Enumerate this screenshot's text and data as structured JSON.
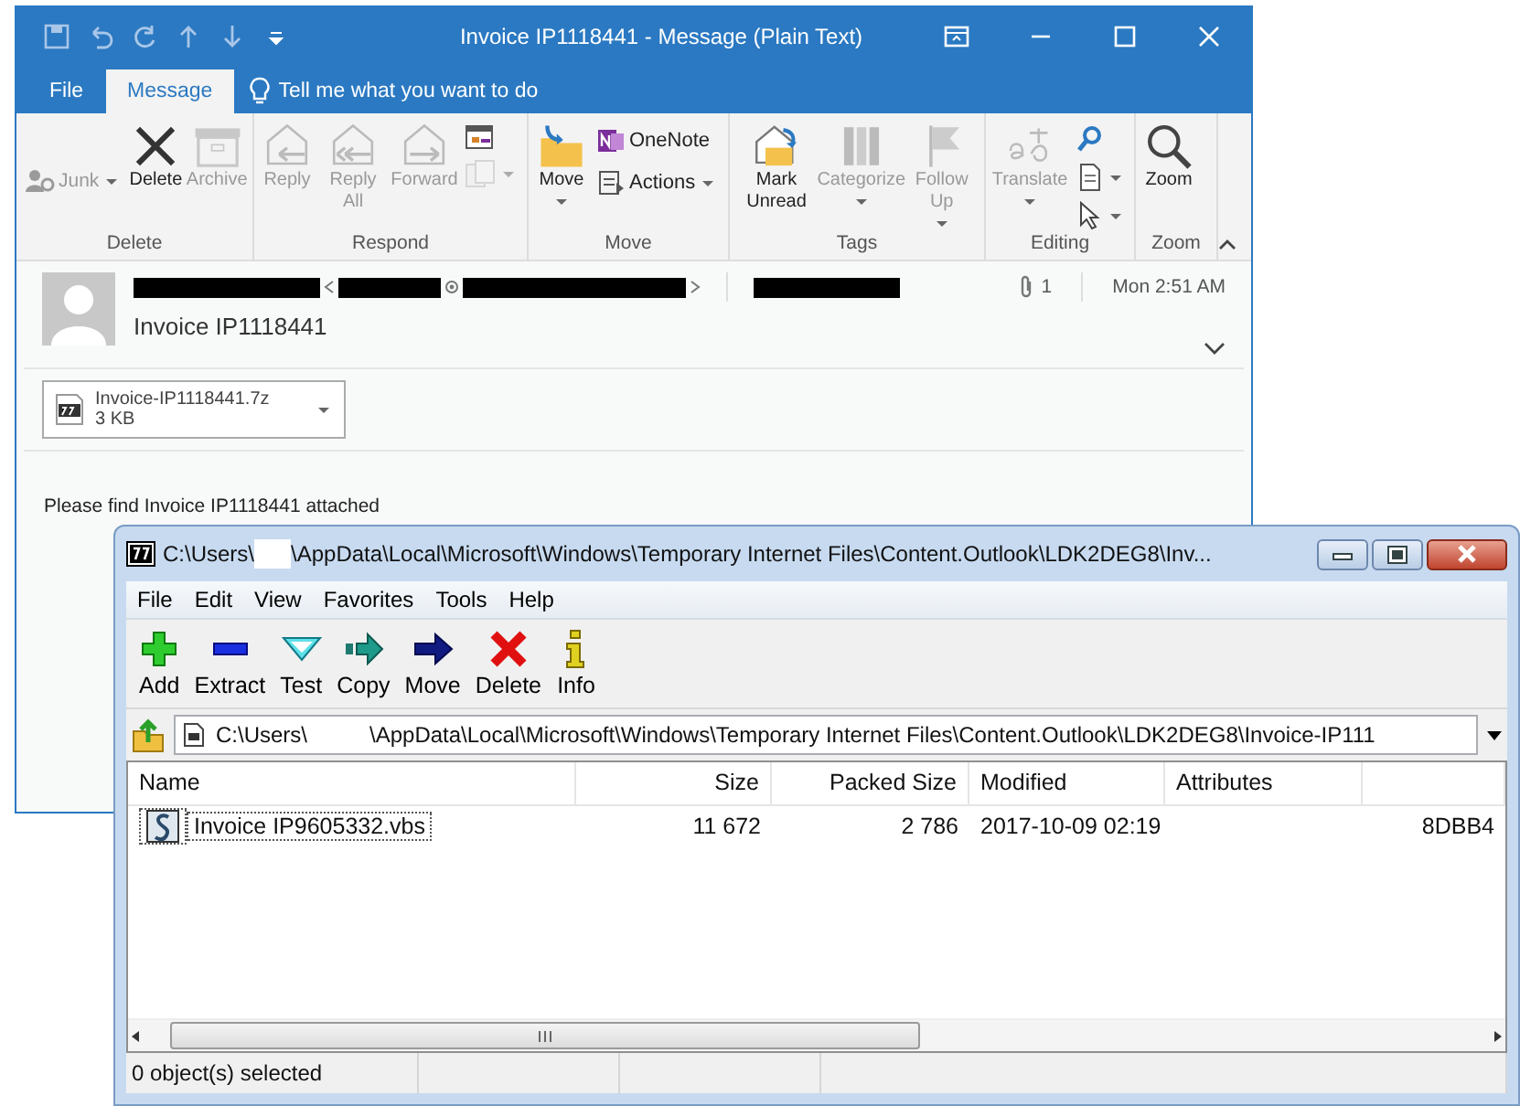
{
  "outlook": {
    "title": "Invoice IP1118441 - Message (Plain Text)",
    "tabs": [
      {
        "label": "File",
        "selected": false
      },
      {
        "label": "Message",
        "selected": true
      }
    ],
    "tell_me": "Tell me what you want to do",
    "ribbon_groups": [
      {
        "label": "Delete",
        "items": [
          {
            "kind": "small",
            "label": "Junk",
            "disabled": true,
            "dropdown": true
          },
          {
            "kind": "large",
            "label": "Delete",
            "disabled": false,
            "dropdown": false
          },
          {
            "kind": "large",
            "label": "Archive",
            "disabled": true,
            "dropdown": false
          }
        ]
      },
      {
        "label": "Respond",
        "items": [
          {
            "kind": "large",
            "label": "Reply",
            "disabled": true,
            "dropdown": false
          },
          {
            "kind": "large",
            "label": "Reply All",
            "disabled": true,
            "dropdown": false
          },
          {
            "kind": "large",
            "label": "Forward",
            "disabled": true,
            "dropdown": false
          },
          {
            "kind": "icons",
            "icons": [
              {
                "disabled": false,
                "dropdown": false
              },
              {
                "disabled": true,
                "dropdown": true
              }
            ]
          }
        ]
      },
      {
        "label": "Move",
        "items": [
          {
            "kind": "large",
            "label": "Move",
            "disabled": false,
            "dropdown": true
          },
          {
            "kind": "column",
            "rows": [
              {
                "label": "OneNote",
                "disabled": false,
                "dropdown": false
              },
              {
                "label": "Actions",
                "disabled": false,
                "dropdown": true
              }
            ]
          }
        ]
      },
      {
        "label": "Tags",
        "items": [
          {
            "kind": "large",
            "label": "Mark Unread",
            "disabled": false,
            "dropdown": false
          },
          {
            "kind": "large",
            "label": "Categorize",
            "disabled": true,
            "dropdown": true
          },
          {
            "kind": "large",
            "label": "Follow Up",
            "disabled": true,
            "dropdown": true
          }
        ]
      },
      {
        "label": "Editing",
        "items": [
          {
            "kind": "large",
            "label": "Translate",
            "disabled": true,
            "dropdown": true
          },
          {
            "kind": "icons",
            "icons": [
              {
                "disabled": false,
                "dropdown": false
              },
              {
                "disabled": false,
                "dropdown": true
              },
              {
                "disabled": false,
                "dropdown": true
              }
            ]
          }
        ]
      },
      {
        "label": "Zoom",
        "items": [
          {
            "kind": "large",
            "label": "Zoom",
            "disabled": false,
            "dropdown": false
          }
        ]
      }
    ],
    "message": {
      "attachment_count": "1",
      "time": "Mon 2:51 AM",
      "subject": "Invoice IP1118441",
      "attachment": {
        "name": "Invoice-IP1118441.7z",
        "size": "3 KB"
      },
      "body": "Please find Invoice IP1118441 attached"
    }
  },
  "archive_window": {
    "title": [
      "C:\\Users\\",
      "\\AppData\\Local\\Microsoft\\Windows\\Temporary Internet Files\\Content.Outlook\\LDK2DEG8\\Inv..."
    ],
    "menu": [
      "File",
      "Edit",
      "View",
      "Favorites",
      "Tools",
      "Help"
    ],
    "toolbar": [
      "Add",
      "Extract",
      "Test",
      "Copy",
      "Move",
      "Delete",
      "Info"
    ],
    "address": [
      "C:\\Users\\",
      "\\AppData\\Local\\Microsoft\\Windows\\Temporary Internet Files\\Content.Outlook\\LDK2DEG8\\Invoice-IP111"
    ],
    "columns": [
      "Name",
      "Size",
      "Packed Size",
      "Modified",
      "Attributes"
    ],
    "rows": [
      {
        "name": "Invoice IP9605332.vbs",
        "size": "11 672",
        "packed_size": "2 786",
        "modified": "2017-10-09 02:19",
        "column_6": "8DBB4"
      }
    ],
    "status": "0 object(s) selected"
  }
}
